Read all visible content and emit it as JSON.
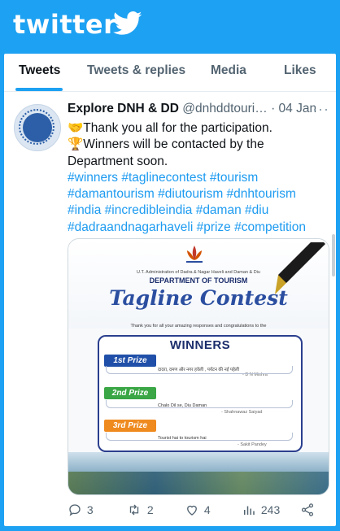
{
  "header": {
    "brand": "twitter"
  },
  "tabs": [
    {
      "label": "Tweets",
      "active": true
    },
    {
      "label": "Tweets & replies",
      "active": false
    },
    {
      "label": "Media",
      "active": false
    },
    {
      "label": "Likes",
      "active": false
    }
  ],
  "tweet": {
    "name": "Explore DNH & DD",
    "handle": "@dnhddtouri…",
    "separator": "·",
    "date": "04 Jan",
    "text_lines": [
      "🤝Thank you all for the participation.",
      "🏆Winners will be contacted by the",
      "Department soon."
    ],
    "hashtag_lines": [
      "#winners #taglinecontest #tourism",
      "#damantourism #diutourism #dnhtourism",
      "#india #incredibleindia #daman #diu",
      "#dadraandnagarhaveli #prize #competition"
    ],
    "media": {
      "gov_text": "U.T. Administration of Dadra & Nagar Haveli and Daman & Diu",
      "department": "DEPARTMENT OF TOURISM",
      "title": "Tagline Contest",
      "thanks": "Thank you for all your amazing responses and congratulations to the",
      "winners_heading": "WINNERS",
      "prizes": [
        {
          "label": "1st Prize",
          "tagline": "दादरा, दमण और नगर हवेली , पर्यटन की नई पहेली",
          "by": "- D N Mishra",
          "color": "#1f4fa8"
        },
        {
          "label": "2nd Prize",
          "tagline": "Chalo Dil se, Diu Daman",
          "by": "- Shahnawaz Saiyad",
          "color": "#3aa645"
        },
        {
          "label": "3rd Prize",
          "tagline": "Tourist hai to tourism hai",
          "by": "- Sakit Pandey",
          "color": "#ef8a1f"
        }
      ]
    },
    "actions": {
      "replies": "3",
      "retweets": "2",
      "likes": "4",
      "views": "243"
    }
  },
  "colors": {
    "brand": "#1da1f2",
    "link": "#1d9bf0",
    "text": "#0f1419",
    "muted": "#536471"
  }
}
